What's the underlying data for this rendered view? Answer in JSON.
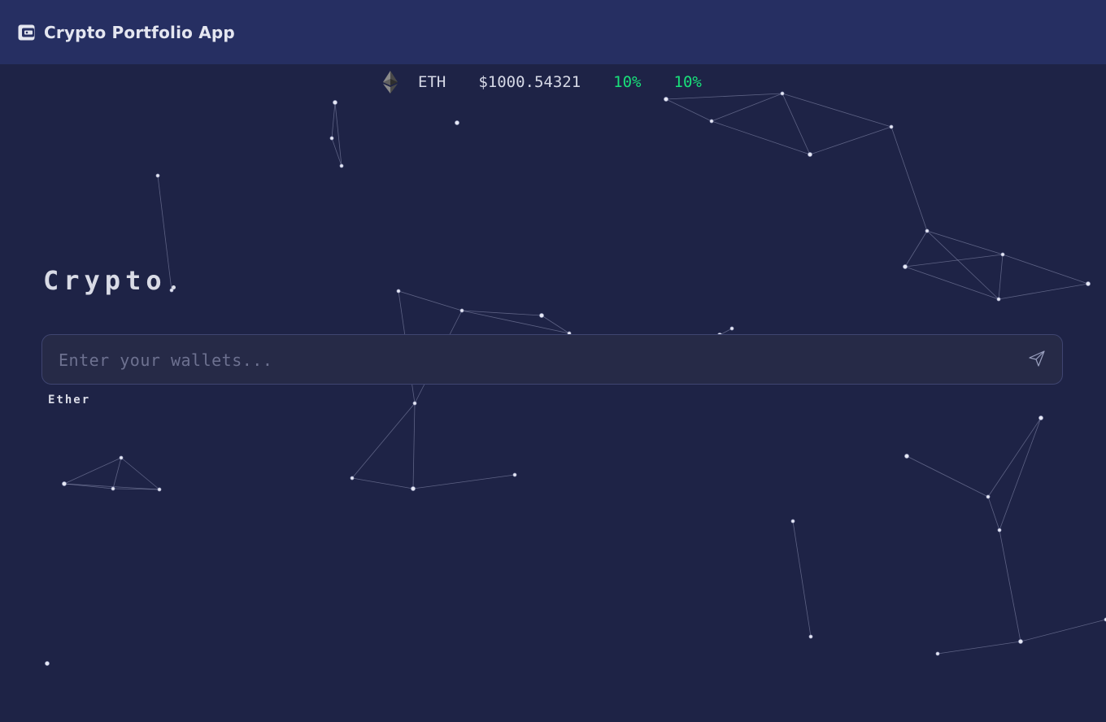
{
  "header": {
    "title": "Crypto Portfolio App",
    "icon": "wallet-icon"
  },
  "ticker": {
    "icon": "ethereum-icon",
    "symbol": "ETH",
    "price": "$1000.54321",
    "change_1": "10%",
    "change_2": "10%",
    "change_color": "#19e07a"
  },
  "main": {
    "heading": "Crypto",
    "wallet_input": {
      "value": "",
      "placeholder": "Enter your wallets..."
    },
    "send_icon": "send-icon",
    "suggestion": "Ether"
  },
  "colors": {
    "background": "#1e2346",
    "topbar": "#262f62",
    "input_bg": "#262a47"
  }
}
